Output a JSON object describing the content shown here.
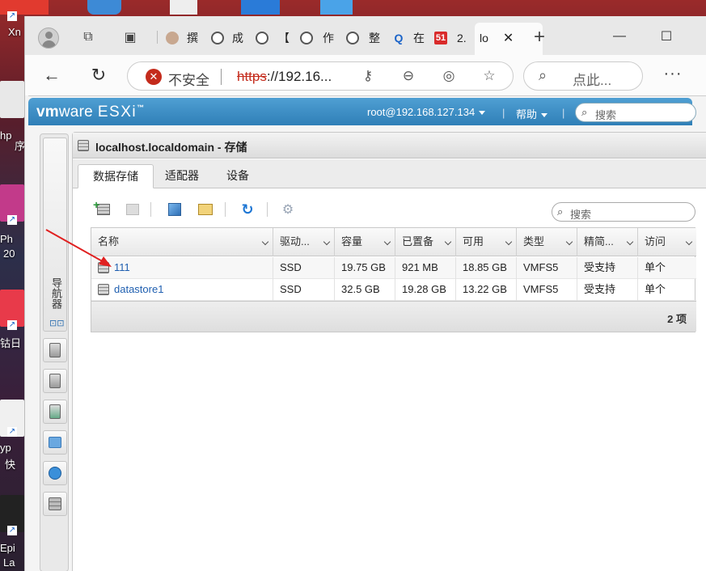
{
  "desktop": {
    "icon_labels": [
      "Xn",
      "hp",
      "序",
      "Ph",
      "20",
      "钴日",
      "yp",
      "快",
      "Epi",
      "La"
    ]
  },
  "browser": {
    "tabs": [
      {
        "title": "撰",
        "icon": "person-favicon"
      },
      {
        "title": "成",
        "icon": "globe-icon"
      },
      {
        "title": "【",
        "icon": "globe-icon"
      },
      {
        "title": "作",
        "icon": "globe-icon"
      },
      {
        "title": "整",
        "icon": "globe-icon"
      },
      {
        "title": "在",
        "icon": "search-favicon"
      },
      {
        "title": "2.",
        "icon": "51-favicon"
      },
      {
        "title": "lo",
        "icon": "none"
      }
    ],
    "new_tab_glyph": "+",
    "address": {
      "security_text": "不安全",
      "scheme": "https",
      "url_rest": "://192.16..."
    },
    "find_placeholder": "点此..."
  },
  "esxi": {
    "logo_vm": "vm",
    "logo_ware": "ware",
    "logo_esxi": "ESXi",
    "user": "root@192.168.127.134",
    "help": "帮助",
    "search_placeholder": "搜索",
    "navigator_label": "导航器",
    "window_title": "localhost.localdomain - 存储",
    "tabs": [
      "数据存储",
      "适配器",
      "设备"
    ],
    "table_search_placeholder": "搜索",
    "columns": [
      "名称",
      "驱动...",
      "容量",
      "已置备",
      "可用",
      "类型",
      "精简...",
      "访问"
    ],
    "rows": [
      {
        "name": "111",
        "drive": "SSD",
        "capacity": "19.75 GB",
        "provisioned": "921 MB",
        "free": "18.85 GB",
        "type": "VMFS5",
        "thin": "受支持",
        "access": "单个"
      },
      {
        "name": "datastore1",
        "drive": "SSD",
        "capacity": "32.5 GB",
        "provisioned": "19.28 GB",
        "free": "13.22 GB",
        "type": "VMFS5",
        "thin": "受支持",
        "access": "单个"
      }
    ],
    "item_count": "2 项"
  },
  "colors": {
    "header_blue": "#2f7fb7",
    "link_blue": "#1f5fb0",
    "annotation_red": "#e02020",
    "insecure_red": "#c42b1c"
  }
}
